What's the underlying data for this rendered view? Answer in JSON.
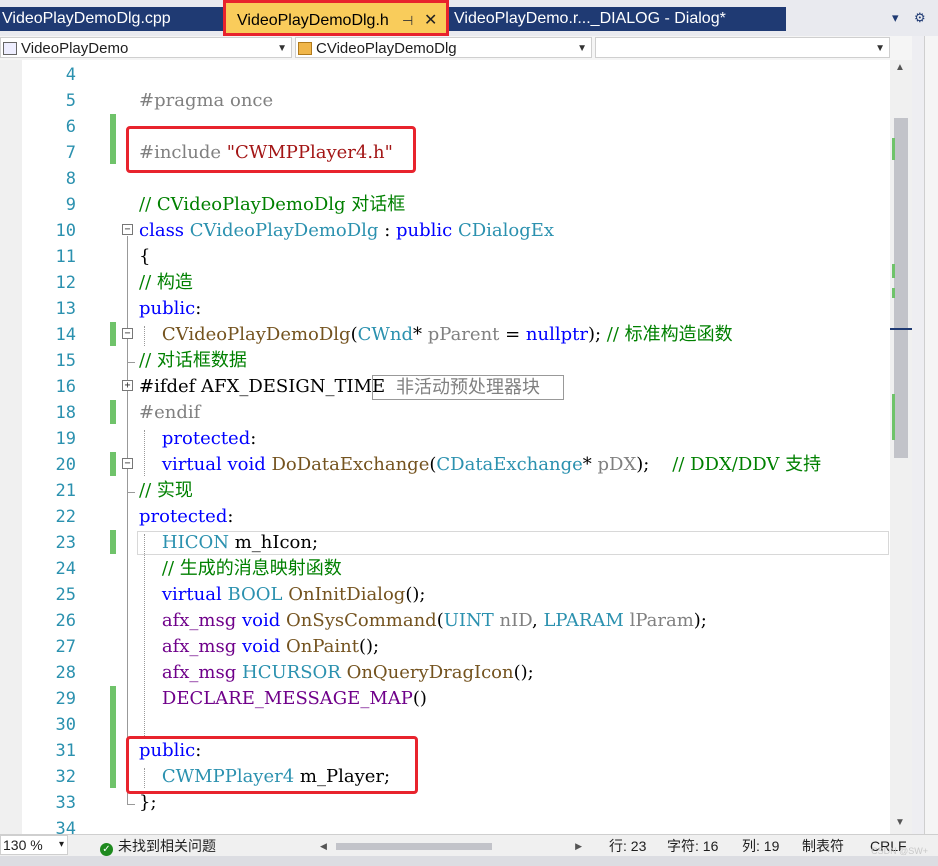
{
  "tabs": [
    {
      "label": "VideoPlayDemoDlg.cpp",
      "active": false
    },
    {
      "label": "VideoPlayDemoDlg.h",
      "active": true
    },
    {
      "label": "VideoPlayDemo.r..._DIALOG - Dialog*",
      "active": false
    }
  ],
  "tab_tools": {
    "dropdown_glyph": "▾",
    "settings_glyph": "⚙"
  },
  "nav": {
    "project": "VideoPlayDemo",
    "class": "CVideoPlayDemoDlg",
    "member": "",
    "splitter_glyph": "⇟"
  },
  "editor": {
    "line_numbers": [
      "4",
      "5",
      "6",
      "7",
      "8",
      "9",
      "10",
      "11",
      "12",
      "13",
      "14",
      "15",
      "16",
      "18",
      "19",
      "20",
      "21",
      "22",
      "23",
      "24",
      "25",
      "26",
      "27",
      "28",
      "29",
      "30",
      "31",
      "32",
      "33",
      "34"
    ],
    "lines": [
      [],
      [
        {
          "t": "#pragma once",
          "c": "pp"
        }
      ],
      [],
      [
        {
          "t": "#include ",
          "c": "pp"
        },
        {
          "t": "\"CWMPPlayer4.h\"",
          "c": "str"
        }
      ],
      [],
      [
        {
          "t": "// CVideoPlayDemoDlg 对话框",
          "c": "cm"
        }
      ],
      [
        {
          "t": "class ",
          "c": "kw"
        },
        {
          "t": "CVideoPlayDemoDlg",
          "c": "ty"
        },
        {
          "t": " : ",
          "c": ""
        },
        {
          "t": "public ",
          "c": "kw"
        },
        {
          "t": "CDialogEx",
          "c": "ty"
        }
      ],
      [
        {
          "t": "{",
          "c": ""
        }
      ],
      [
        {
          "t": "// 构造",
          "c": "cm"
        }
      ],
      [
        {
          "t": "public",
          "c": "kw"
        },
        {
          "t": ":",
          "c": ""
        }
      ],
      [
        {
          "t": "    ",
          "c": ""
        },
        {
          "t": "CVideoPlayDemoDlg",
          "c": "fn"
        },
        {
          "t": "(",
          "c": ""
        },
        {
          "t": "CWnd",
          "c": "ty"
        },
        {
          "t": "* ",
          "c": ""
        },
        {
          "t": "pParent",
          "c": "gr"
        },
        {
          "t": " = ",
          "c": ""
        },
        {
          "t": "nullptr",
          "c": "kw"
        },
        {
          "t": "); ",
          "c": ""
        },
        {
          "t": "// 标准构造函数",
          "c": "cm"
        }
      ],
      [
        {
          "t": "// 对话框数据",
          "c": "cm"
        }
      ],
      [
        {
          "t": "#ifdef AFX_DESIGN_TIME",
          "c": ""
        }
      ],
      [
        {
          "t": "#endif",
          "c": "pp"
        }
      ],
      [
        {
          "t": "    ",
          "c": ""
        },
        {
          "t": "protected",
          "c": "kw"
        },
        {
          "t": ":",
          "c": ""
        }
      ],
      [
        {
          "t": "    ",
          "c": ""
        },
        {
          "t": "virtual ",
          "c": "kw"
        },
        {
          "t": "void ",
          "c": "kw"
        },
        {
          "t": "DoDataExchange",
          "c": "fn"
        },
        {
          "t": "(",
          "c": ""
        },
        {
          "t": "CDataExchange",
          "c": "ty"
        },
        {
          "t": "* ",
          "c": ""
        },
        {
          "t": "pDX",
          "c": "gr"
        },
        {
          "t": ");    ",
          "c": ""
        },
        {
          "t": "// DDX/DDV 支持",
          "c": "cm"
        }
      ],
      [
        {
          "t": "// 实现",
          "c": "cm"
        }
      ],
      [
        {
          "t": "protected",
          "c": "kw"
        },
        {
          "t": ":",
          "c": ""
        }
      ],
      [
        {
          "t": "    ",
          "c": ""
        },
        {
          "t": "HICON",
          "c": "ty"
        },
        {
          "t": " m_hIcon;",
          "c": ""
        }
      ],
      [
        {
          "t": "    ",
          "c": ""
        },
        {
          "t": "// 生成的消息映射函数",
          "c": "cm"
        }
      ],
      [
        {
          "t": "    ",
          "c": ""
        },
        {
          "t": "virtual ",
          "c": "kw"
        },
        {
          "t": "BOOL ",
          "c": "ty"
        },
        {
          "t": "OnInitDialog",
          "c": "fn"
        },
        {
          "t": "();",
          "c": ""
        }
      ],
      [
        {
          "t": "    ",
          "c": ""
        },
        {
          "t": "afx_msg ",
          "c": "mac"
        },
        {
          "t": "void ",
          "c": "kw"
        },
        {
          "t": "OnSysCommand",
          "c": "fn"
        },
        {
          "t": "(",
          "c": ""
        },
        {
          "t": "UINT ",
          "c": "ty"
        },
        {
          "t": "nID",
          "c": "gr"
        },
        {
          "t": ", ",
          "c": ""
        },
        {
          "t": "LPARAM ",
          "c": "ty"
        },
        {
          "t": "lParam",
          "c": "gr"
        },
        {
          "t": ");",
          "c": ""
        }
      ],
      [
        {
          "t": "    ",
          "c": ""
        },
        {
          "t": "afx_msg ",
          "c": "mac"
        },
        {
          "t": "void ",
          "c": "kw"
        },
        {
          "t": "OnPaint",
          "c": "fn"
        },
        {
          "t": "();",
          "c": ""
        }
      ],
      [
        {
          "t": "    ",
          "c": ""
        },
        {
          "t": "afx_msg ",
          "c": "mac"
        },
        {
          "t": "HCURSOR ",
          "c": "ty"
        },
        {
          "t": "OnQueryDragIcon",
          "c": "fn"
        },
        {
          "t": "();",
          "c": ""
        }
      ],
      [
        {
          "t": "    ",
          "c": ""
        },
        {
          "t": "DECLARE_MESSAGE_MAP",
          "c": "mac"
        },
        {
          "t": "()",
          "c": ""
        }
      ],
      [],
      [
        {
          "t": "public",
          "c": "kw"
        },
        {
          "t": ":",
          "c": ""
        }
      ],
      [
        {
          "t": "    ",
          "c": ""
        },
        {
          "t": "CWMPPlayer4",
          "c": "ty"
        },
        {
          "t": " m_Player;",
          "c": ""
        }
      ],
      [
        {
          "t": "};",
          "c": ""
        }
      ],
      []
    ],
    "collapsed_label": "非活动预处理器块",
    "fold_collapsed_glyph": "+",
    "fold_expanded_glyph": "−"
  },
  "scrollbar_glyphs": {
    "up": "▲",
    "down": "▼",
    "left": "◀",
    "right": "▶"
  },
  "status": {
    "zoom": "130 %",
    "zoom_arrow": "▾",
    "issues_icon_glyph": "✓",
    "issues": "未找到相关问题",
    "row": "行: 23",
    "char": "字符: 16",
    "col": "列: 19",
    "tab_mode": "制表符",
    "eol": "CRLF"
  },
  "watermark": "CSDN @SW+"
}
